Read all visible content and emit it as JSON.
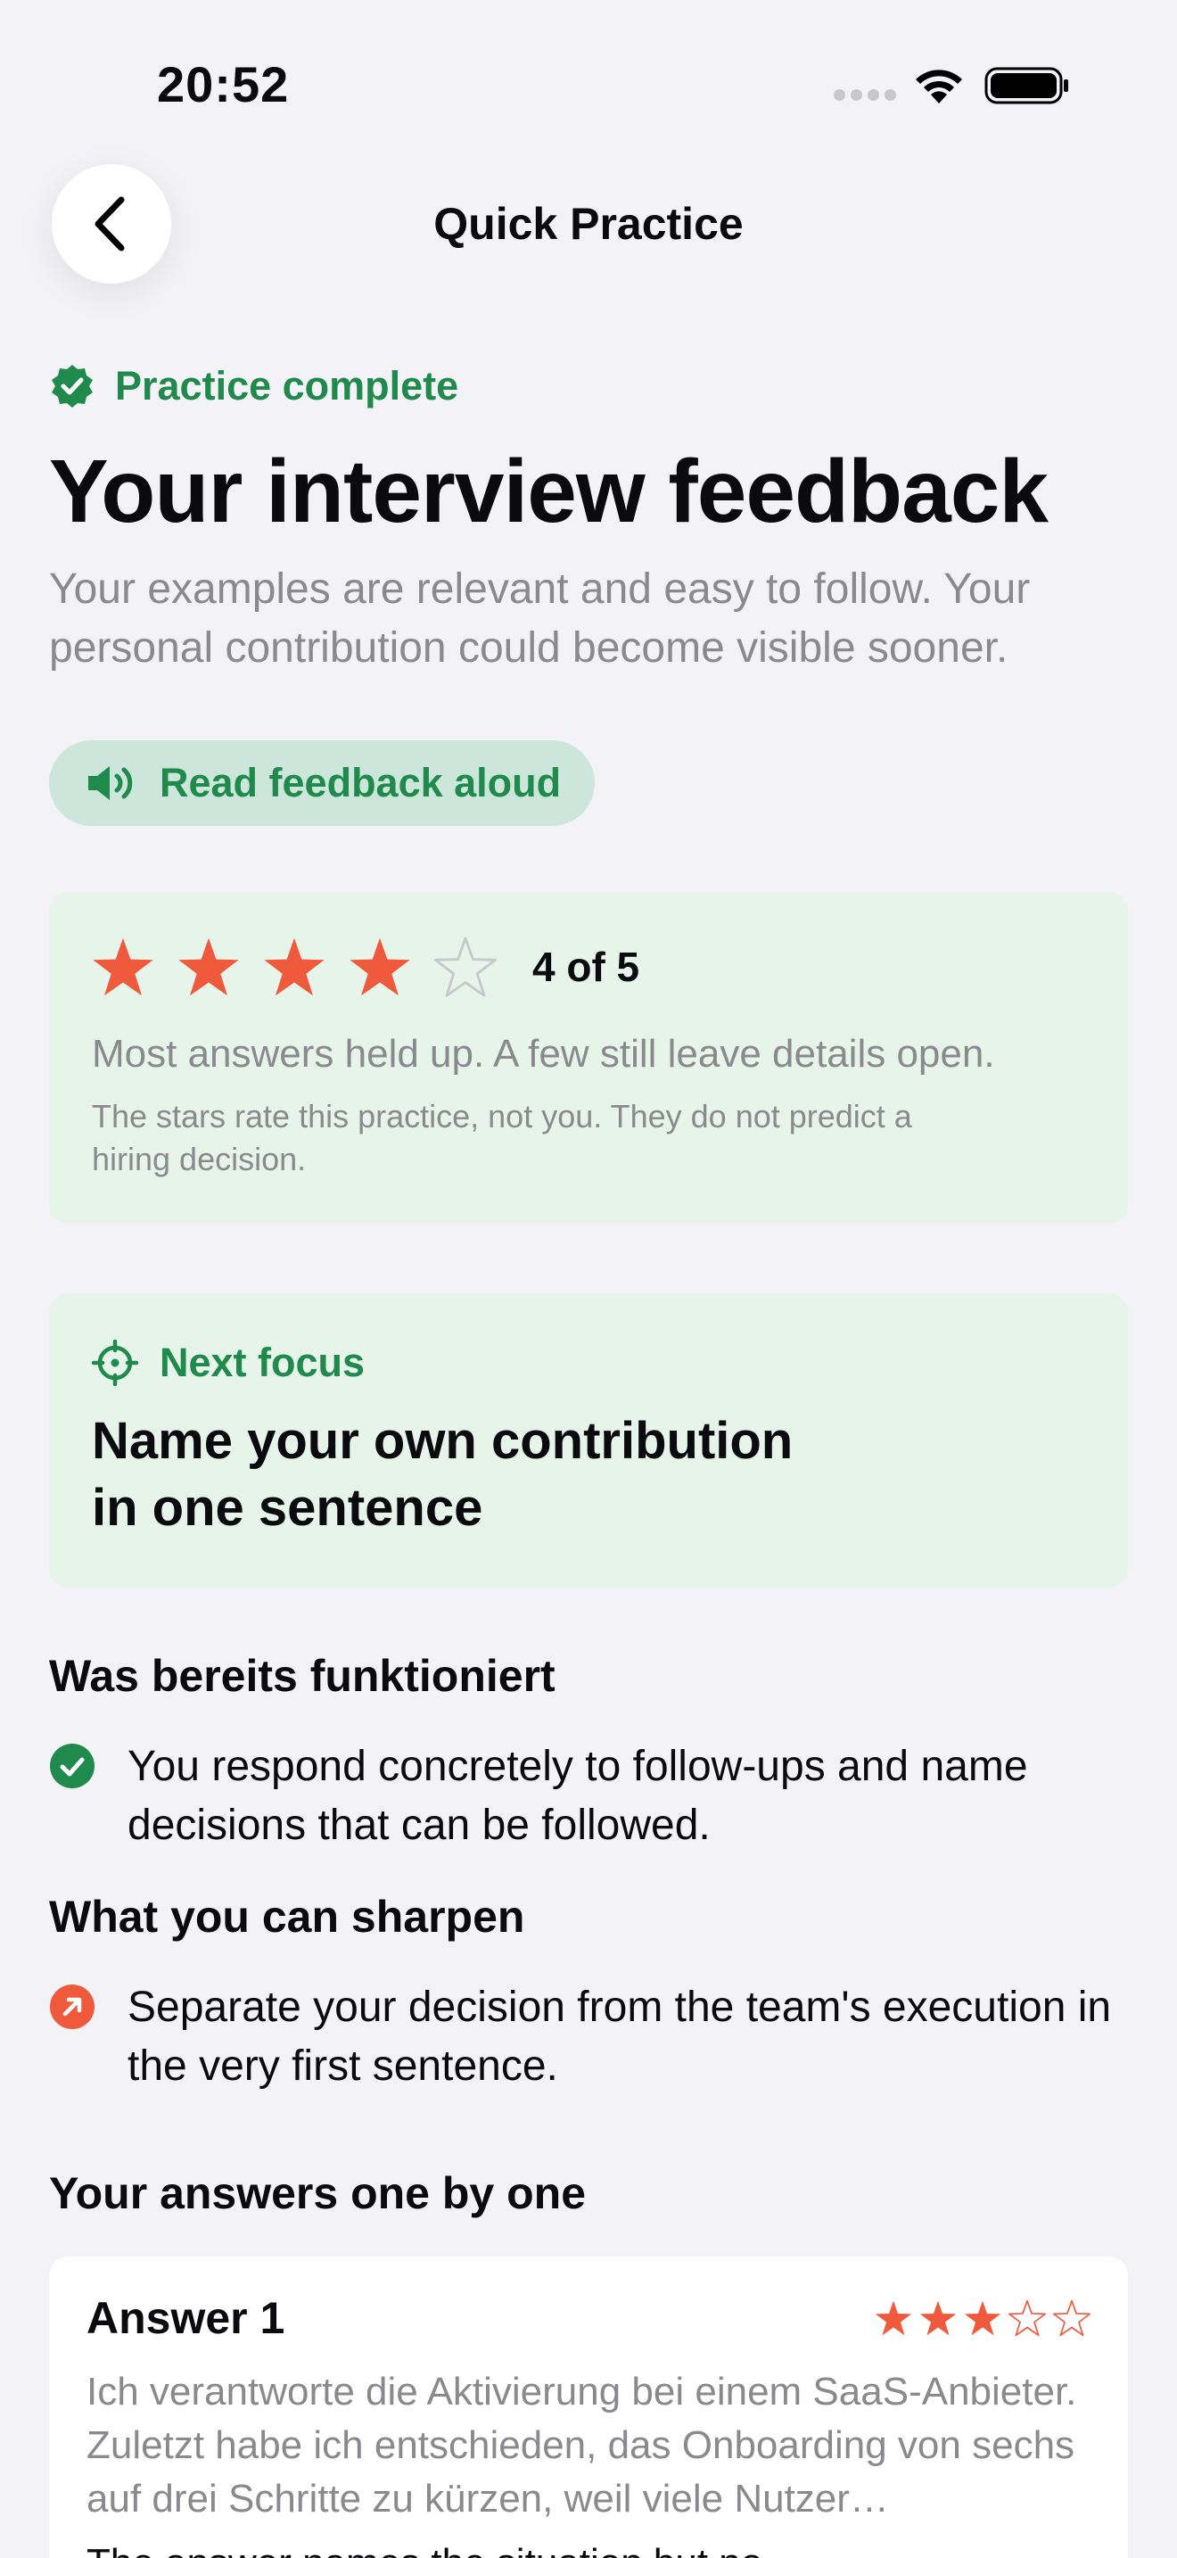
{
  "status": {
    "time": "20:52"
  },
  "nav": {
    "title": "Quick Practice"
  },
  "header": {
    "complete_label": "Practice complete",
    "title": "Your interview feedback",
    "summary": "Your examples are relevant and easy to follow. Your personal contribution could become visible sooner.",
    "read_aloud_label": "Read feedback aloud"
  },
  "rating": {
    "stars_filled": 4,
    "stars_total": 5,
    "label": "4 of 5",
    "description": "Most answers held up. A few still leave details open.",
    "note": "The stars rate this practice, not you. They do not predict a hiring decision."
  },
  "focus": {
    "label": "Next focus",
    "text": "Name your own contribution in one sentence"
  },
  "strengths": {
    "title": "Was bereits funktioniert",
    "items": [
      "You respond concretely to follow-ups and name decisions that can be followed."
    ]
  },
  "improvements": {
    "title": "What you can sharpen",
    "items": [
      "Separate your decision from the team's execution in the very first sentence."
    ]
  },
  "answers": {
    "title": "Your answers one by one",
    "items": [
      {
        "title": "Answer 1",
        "stars_filled": 3,
        "stars_total": 5,
        "quote": "Ich verantworte die Aktivierung bei einem SaaS-Anbieter. Zuletzt habe ich entschieden, das Onboarding von sechs auf drei Schritte zu kürzen, weil viele Nutzer abgesprungen sind.",
        "note": "The answer names the situation but no"
      }
    ]
  },
  "colors": {
    "accent_green": "#1f8a4c",
    "star_red": "#ef5a3c",
    "card_green": "#e6f4ea",
    "pill_green": "#cde6dc"
  },
  "icons": {
    "back": "chevron-left-icon",
    "complete": "verified-badge-icon",
    "speaker": "speaker-icon",
    "focus": "crosshair-icon",
    "strength": "check-circle-icon",
    "improvement": "arrow-up-right-circle-icon"
  }
}
